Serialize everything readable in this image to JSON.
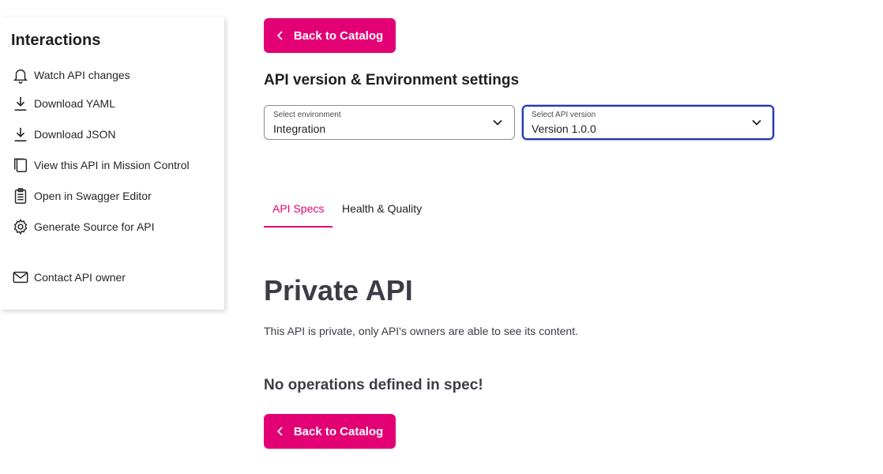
{
  "sidebar": {
    "title": "Interactions",
    "items": [
      {
        "label": "Watch API changes",
        "icon": "bell-icon"
      },
      {
        "label": "Download YAML",
        "icon": "download-icon"
      },
      {
        "label": "Download JSON",
        "icon": "download-icon"
      },
      {
        "label": "View this API in Mission Control",
        "icon": "copy-icon"
      },
      {
        "label": "Open in Swagger Editor",
        "icon": "clipboard-icon"
      },
      {
        "label": "Generate Source for API",
        "icon": "gear-icon"
      },
      {
        "label": "Contact API owner",
        "icon": "mail-icon"
      }
    ]
  },
  "main": {
    "back_label": "Back to Catalog",
    "section_title": "API version & Environment settings",
    "environment": {
      "label": "Select environment",
      "value": "Integration"
    },
    "version": {
      "label": "Select API version",
      "value": "Version 1.0.0"
    },
    "tabs": [
      {
        "label": "API Specs",
        "active": true
      },
      {
        "label": "Health & Quality",
        "active": false
      }
    ],
    "private_title": "Private API",
    "private_description": "This API is private, only API's owners are able to see its content.",
    "no_operations": "No operations defined in spec!"
  },
  "colors": {
    "accent": "#e20074",
    "focus": "#2238b2",
    "text_dark": "#3c3c46"
  }
}
